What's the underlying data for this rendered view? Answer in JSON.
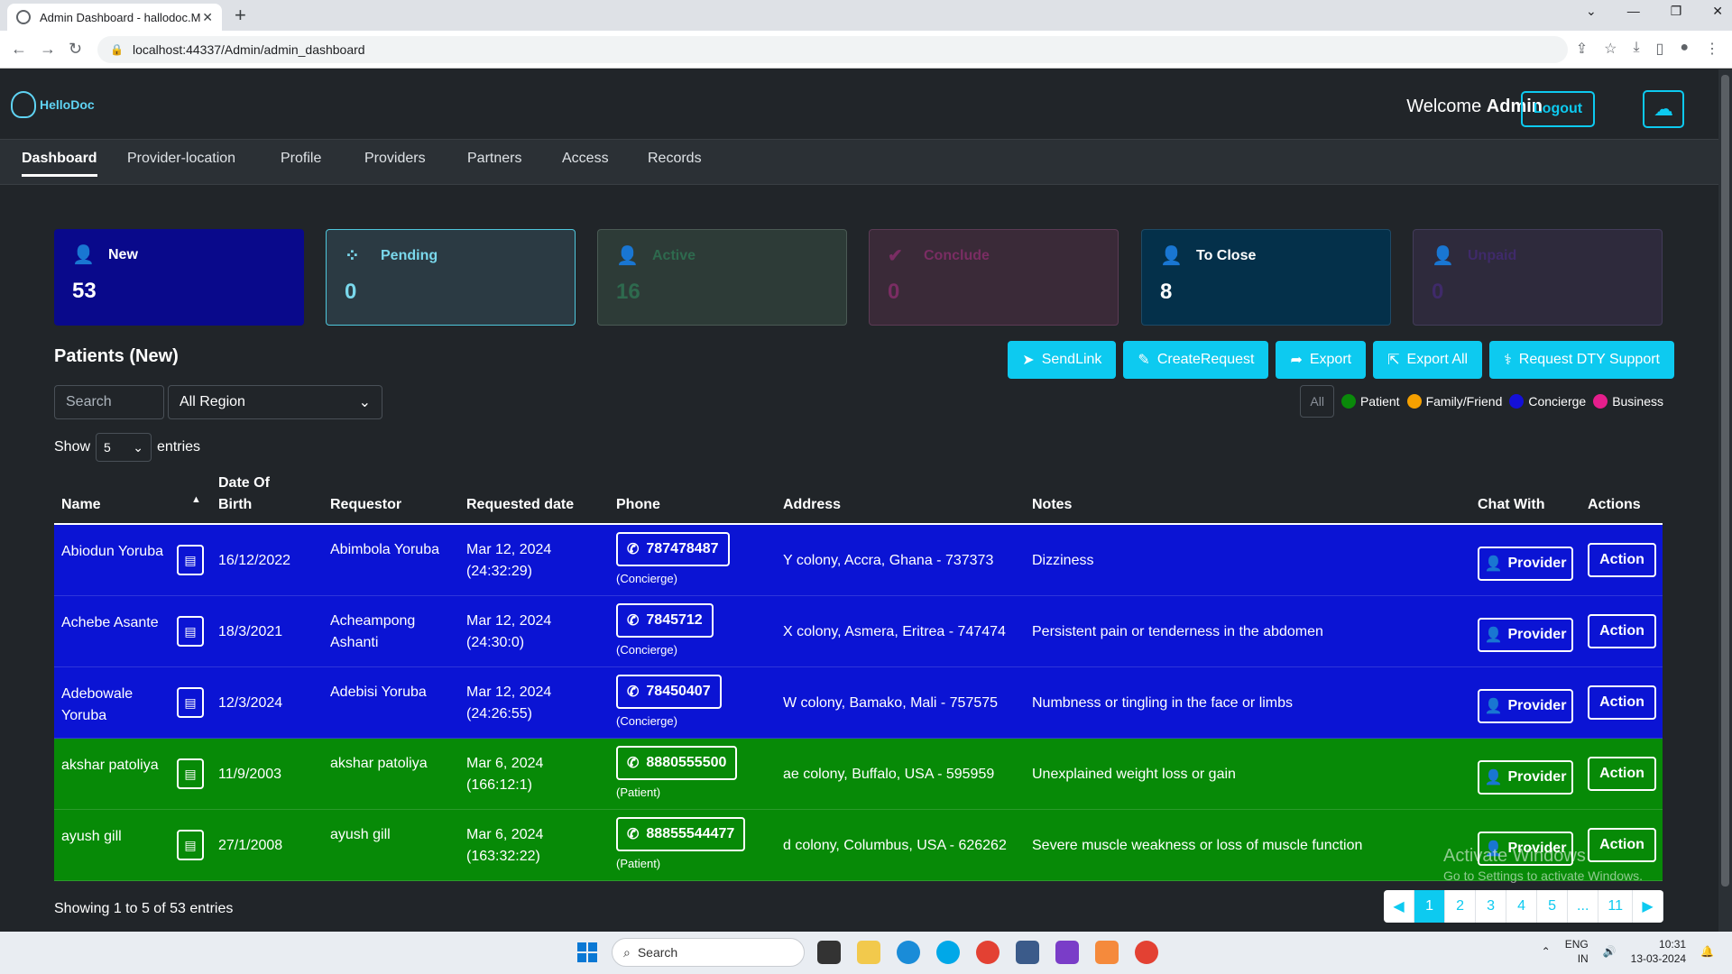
{
  "browser": {
    "tab_title": "Admin Dashboard - hallodoc.M",
    "url": "localhost:44337/Admin/admin_dashboard"
  },
  "header": {
    "logo_text": "HelloDoc",
    "welcome_label": "Welcome",
    "welcome_user": "Admin",
    "logout_label": "Logout"
  },
  "nav": [
    "Dashboard",
    "Provider-location",
    "Profile",
    "Providers",
    "Partners",
    "Access",
    "Records"
  ],
  "cards": [
    {
      "label": "New",
      "count": "53",
      "icon": "user-plus-icon"
    },
    {
      "label": "Pending",
      "count": "0",
      "icon": "spinner-icon"
    },
    {
      "label": "Active",
      "count": "16",
      "icon": "user-check-icon"
    },
    {
      "label": "Conclude",
      "count": "0",
      "icon": "double-check-icon"
    },
    {
      "label": "To Close",
      "count": "8",
      "icon": "user-x-icon"
    },
    {
      "label": "Unpaid",
      "count": "0",
      "icon": "user-dollar-icon"
    }
  ],
  "section_title": "Patients (New)",
  "action_buttons": [
    "SendLink",
    "CreateRequest",
    "Export",
    "Export All",
    "Request DTY Support"
  ],
  "search_placeholder": "Search",
  "region_selected": "All Region",
  "filters": {
    "all_label": "All",
    "legend": [
      {
        "label": "Patient",
        "color": "#0a8a0a"
      },
      {
        "label": "Family/Friend",
        "color": "#f5a000"
      },
      {
        "label": "Concierge",
        "color": "#1410d8"
      },
      {
        "label": "Business",
        "color": "#e51e8c"
      }
    ]
  },
  "entries": {
    "show_label": "Show",
    "value": "5",
    "suffix": "entries"
  },
  "columns": [
    "Name",
    "Date Of Birth",
    "Requestor",
    "Requested date",
    "Phone",
    "Address",
    "Notes",
    "Chat With",
    "Actions"
  ],
  "rows": [
    {
      "name": "Abiodun Yoruba",
      "dob": "16/12/2022",
      "requestor": "Abimbola Yoruba",
      "req_date": "Mar 12, 2024",
      "req_time": "(24:32:29)",
      "phone": "787478487",
      "phone_type": "(Concierge)",
      "address": "Y colony, Accra, Ghana - 737373",
      "notes": "Dizziness",
      "chat": "Provider",
      "action": "Action",
      "type": "concierge"
    },
    {
      "name": "Achebe Asante",
      "dob": "18/3/2021",
      "requestor": "Acheampong Ashanti",
      "req_date": "Mar 12, 2024",
      "req_time": "(24:30:0)",
      "phone": "7845712",
      "phone_type": "(Concierge)",
      "address": "X colony, Asmera, Eritrea - 747474",
      "notes": "Persistent pain or tenderness in the abdomen",
      "chat": "Provider",
      "action": "Action",
      "type": "concierge"
    },
    {
      "name": "Adebowale Yoruba",
      "dob": "12/3/2024",
      "requestor": "Adebisi Yoruba",
      "req_date": "Mar 12, 2024",
      "req_time": "(24:26:55)",
      "phone": "78450407",
      "phone_type": "(Concierge)",
      "address": "W colony, Bamako, Mali - 757575",
      "notes": "Numbness or tingling in the face or limbs",
      "chat": "Provider",
      "action": "Action",
      "type": "concierge"
    },
    {
      "name": "akshar patoliya",
      "dob": "11/9/2003",
      "requestor": "akshar patoliya",
      "req_date": "Mar 6, 2024",
      "req_time": "(166:12:1)",
      "phone": "8880555500",
      "phone_type": "(Patient)",
      "address": "ae colony, Buffalo, USA - 595959",
      "notes": "Unexplained weight loss or gain",
      "chat": "Provider",
      "action": "Action",
      "type": "patient"
    },
    {
      "name": "ayush gill",
      "dob": "27/1/2008",
      "requestor": "ayush gill",
      "req_date": "Mar 6, 2024",
      "req_time": "(163:32:22)",
      "phone": "88855544477",
      "phone_type": "(Patient)",
      "address": "d colony, Columbus, USA - 626262",
      "notes": "Severe muscle weakness or loss of muscle function",
      "chat": "Provider",
      "action": "Action",
      "type": "patient"
    }
  ],
  "footer_info": "Showing 1 to 5 of 53 entries",
  "pagination": [
    "1",
    "2",
    "3",
    "4",
    "5",
    "...",
    "11"
  ],
  "watermark": {
    "line1": "Activate Windows",
    "line2": "Go to Settings to activate Windows."
  },
  "taskbar": {
    "search_label": "Search",
    "lang": "ENG",
    "region": "IN",
    "time": "10:31",
    "date": "13-03-2024"
  }
}
